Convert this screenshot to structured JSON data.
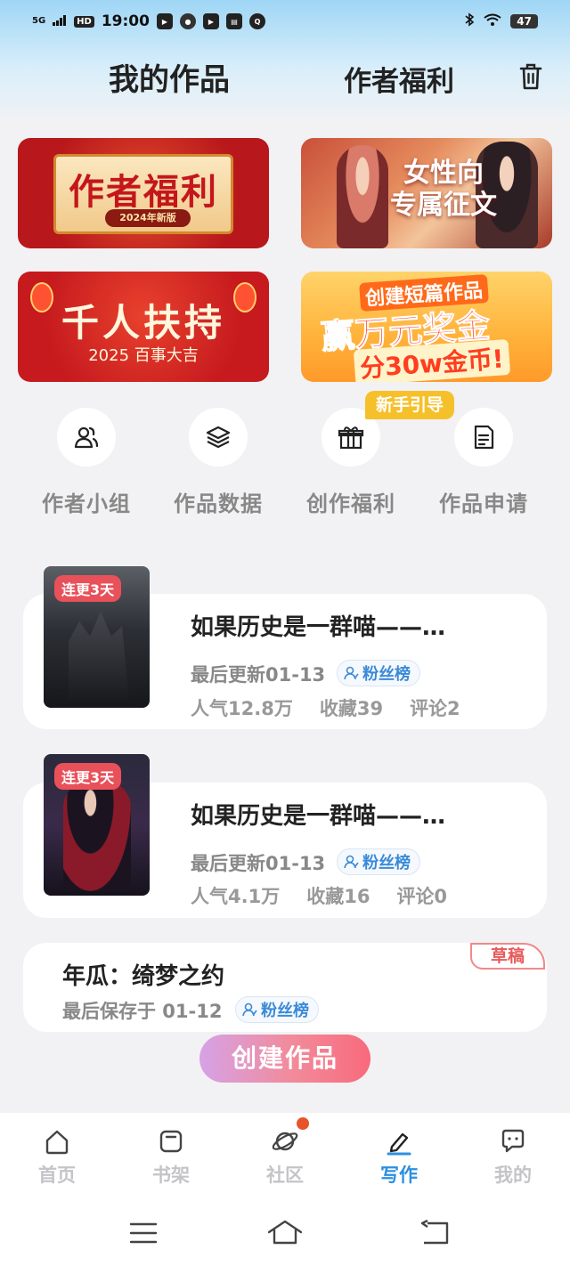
{
  "status_bar": {
    "signal": "5G",
    "hd": "HD",
    "time": "19:00",
    "apps": [
      "youku-icon",
      "wechat-icon",
      "video-icon",
      "book-icon",
      "search-app-icon"
    ],
    "battery": "47"
  },
  "header": {
    "tab_works": "我的作品",
    "tab_welfare": "作者福利"
  },
  "banners": {
    "b1_title": "作者福利",
    "b1_sub": "2024年新版",
    "b2_title_l1": "女性向",
    "b2_title_l2": "专属征文",
    "b3_title": "千人扶持",
    "b3_sub": "2025 百事大吉",
    "b4_l1": "创建短篇作品",
    "b4_l2": "赢万元奖金",
    "b4_l3": "分30w金币!"
  },
  "quick": {
    "newbie": "新手引导",
    "items": [
      {
        "label": "作者小组",
        "icon": "group-icon"
      },
      {
        "label": "作品数据",
        "icon": "layers-icon"
      },
      {
        "label": "创作福利",
        "icon": "gift-icon"
      },
      {
        "label": "作品申请",
        "icon": "document-icon"
      }
    ]
  },
  "works": [
    {
      "streak": "连更3天",
      "title": "如果历史是一群喵——…",
      "updated": "最后更新01-13",
      "fans": "粉丝榜",
      "popularity": "人气12.8万",
      "favorites": "收藏39",
      "comments": "评论2"
    },
    {
      "streak": "连更3天",
      "title": "如果历史是一群喵——…",
      "updated": "最后更新01-13",
      "fans": "粉丝榜",
      "popularity": "人气4.1万",
      "favorites": "收藏16",
      "comments": "评论0"
    }
  ],
  "draft": {
    "tag": "草稿",
    "title": "年瓜：绮梦之约",
    "saved": "最后保存于 01-12",
    "fans": "粉丝榜"
  },
  "create_button": "创建作品",
  "bottom_nav": [
    {
      "label": "首页",
      "icon": "home-icon"
    },
    {
      "label": "书架",
      "icon": "bookshelf-icon"
    },
    {
      "label": "社区",
      "icon": "planet-icon"
    },
    {
      "label": "写作",
      "icon": "pen-icon",
      "active": true
    },
    {
      "label": "我的",
      "icon": "chat-icon"
    }
  ],
  "colors": {
    "accent": "#2d8fe0",
    "streak_tag": "#e8515a",
    "fans_text": "#3a8ad8"
  }
}
